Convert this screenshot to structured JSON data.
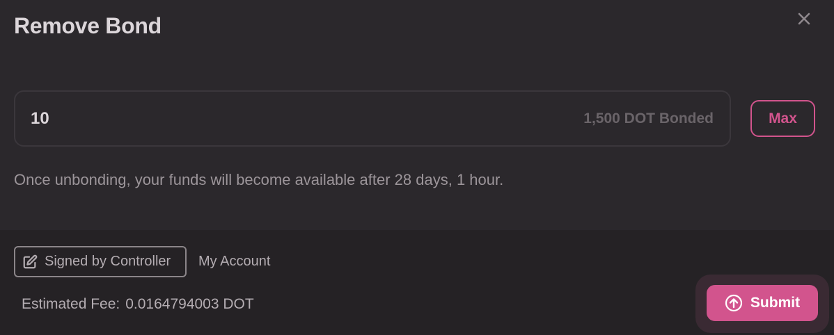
{
  "modal": {
    "title": "Remove Bond",
    "close_icon": "close-icon"
  },
  "amount": {
    "value": "10",
    "bonded_label": "1,500 DOT Bonded",
    "max_label": "Max"
  },
  "notice": "Once unbonding, your funds will become available after 28 days, 1 hour.",
  "footer": {
    "signed_label": "Signed by Controller",
    "signed_icon": "edit-icon",
    "account_label": "My Account",
    "fee_label": "Estimated Fee:",
    "fee_value": "0.0164794003 DOT",
    "submit_label": "Submit",
    "submit_icon": "arrow-up-circle-icon"
  },
  "colors": {
    "accent": "#d2548d",
    "background": "#2b282c",
    "footer_background": "#252225"
  }
}
